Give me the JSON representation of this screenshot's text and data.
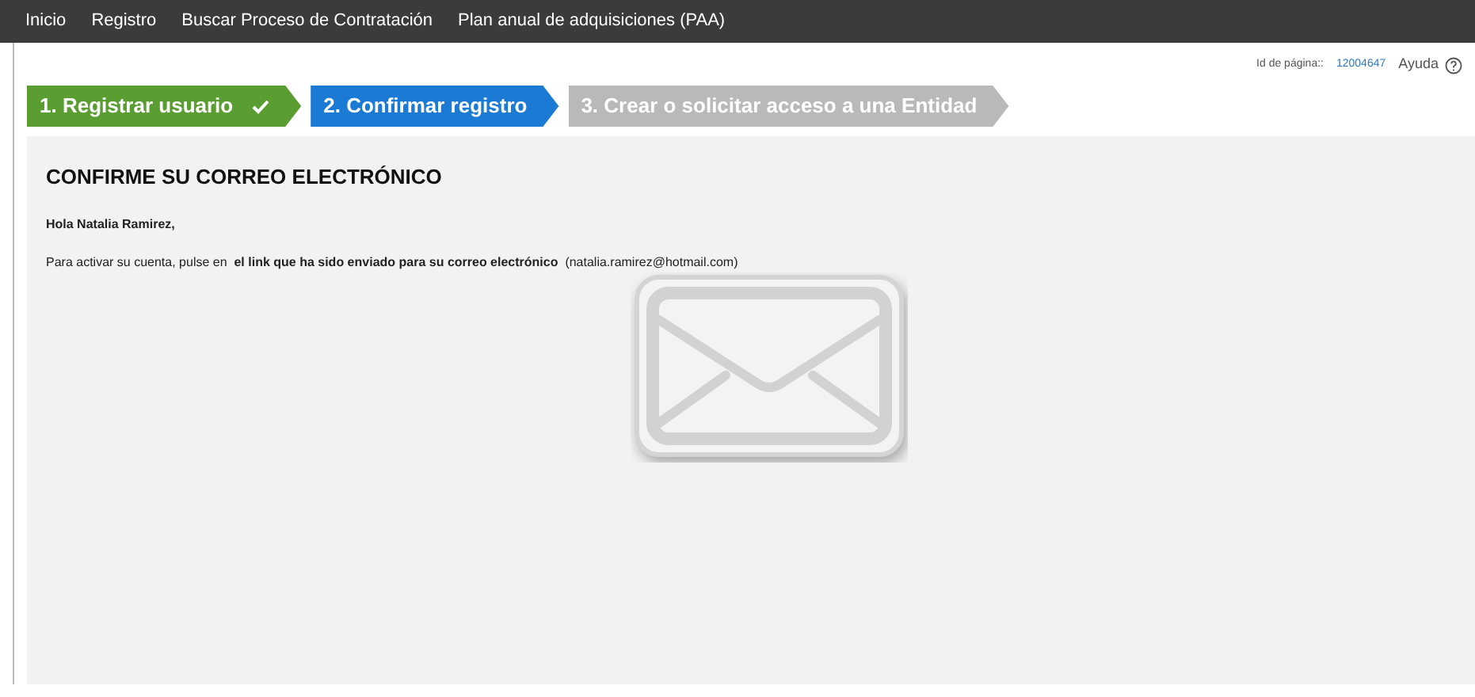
{
  "nav": [
    "Inicio",
    "Registro",
    "Buscar Proceso de Contratación",
    "Plan anual de adquisiciones (PAA)"
  ],
  "page_id": {
    "label": "Id de página::",
    "value": "12004647"
  },
  "help": {
    "label": "Ayuda"
  },
  "steps": [
    {
      "label": "1. Registrar usuario",
      "completed": true,
      "selected": false
    },
    {
      "label": "2. Confirmar registro",
      "completed": false,
      "selected": true
    },
    {
      "label": "3. Crear o solicitar acceso a una Entidad",
      "completed": false,
      "selected": false
    }
  ],
  "heading": "CONFIRME SU CORREO ELECTRÓNICO",
  "greeting": "Hola Natalia Ramirez,",
  "message": "Para activar su cuenta, pulse en  **el link que ha sido enviado para su correo electrónico**  (natalia.ramirez@hotmail.com)"
}
